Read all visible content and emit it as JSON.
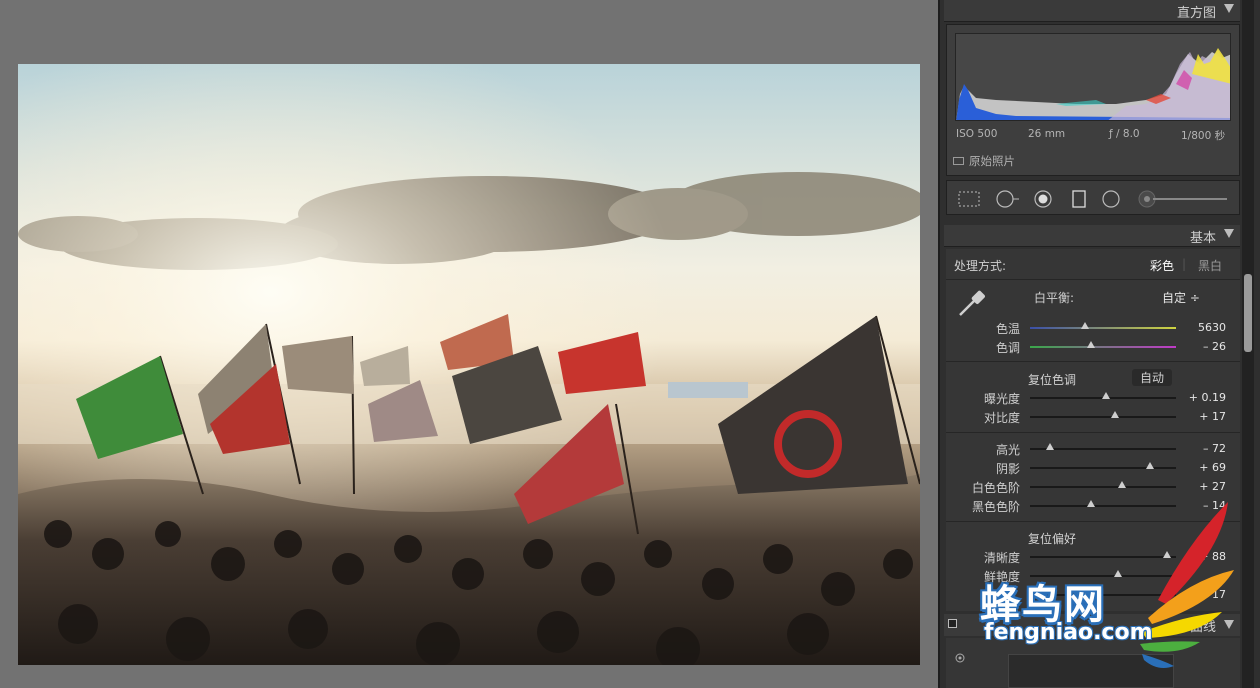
{
  "photo": {
    "description_visible": ""
  },
  "histogram": {
    "title": "直方图",
    "iso": "ISO 500",
    "focal": "26 mm",
    "aperture": "ƒ / 8.0",
    "shutter": "1/800 秒",
    "original_photo_label": "原始照片"
  },
  "basic": {
    "title": "基本",
    "treatment_label": "处理方式:",
    "treatment_color": "彩色",
    "treatment_bw": "黑白",
    "wb_label": "白平衡:",
    "wb_value": "自定 ÷",
    "temp_label": "色温",
    "temp_value": "5630",
    "temp_pos": 0.38,
    "tint_label": "色调",
    "tint_value": "– 26",
    "tint_pos": 0.42,
    "tone_header": "复位色调",
    "tone_auto": "自动",
    "exposure_label": "曝光度",
    "exposure_value": "+ 0.19",
    "exposure_pos": 0.52,
    "contrast_label": "对比度",
    "contrast_value": "+ 17",
    "contrast_pos": 0.58,
    "highlights_label": "高光",
    "highlights_value": "– 72",
    "highlights_pos": 0.14,
    "shadows_label": "阴影",
    "shadows_value": "+ 69",
    "shadows_pos": 0.82,
    "whites_label": "白色色阶",
    "whites_value": "+ 27",
    "whites_pos": 0.63,
    "blacks_label": "黑色色阶",
    "blacks_value": "– 14",
    "blacks_pos": 0.42,
    "presence_header": "复位偏好",
    "clarity_label": "清晰度",
    "clarity_value": "+ 88",
    "clarity_pos": 0.94,
    "vibrance_label": "鲜艳度",
    "vibrance_value": "",
    "vibrance_pos": 0.6,
    "saturation_value": "– 17",
    "saturation_pos": 0.4
  },
  "curve": {
    "title": "曲线"
  },
  "watermark": {
    "cn": "蜂鸟网",
    "en": "fengniao.com"
  },
  "colors": {
    "panel_bg": "#2f2f2f",
    "canvas_bg": "#727272",
    "accent_red": "#d5232a",
    "accent_blue": "#2a6fb8"
  }
}
